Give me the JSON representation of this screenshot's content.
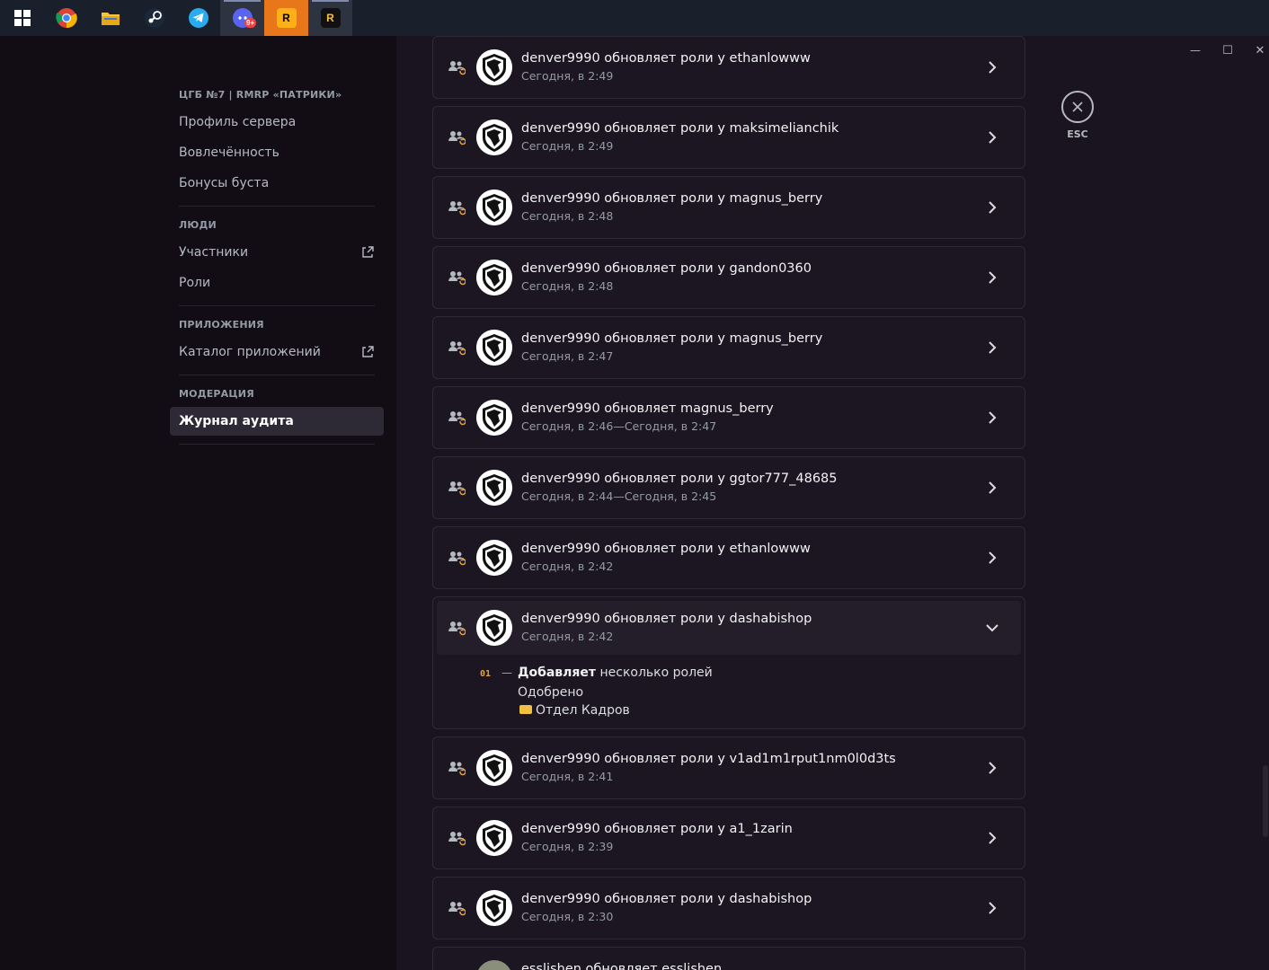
{
  "taskbar": {
    "items": [
      {
        "name": "windows-start",
        "label": ""
      },
      {
        "name": "chrome",
        "label": ""
      },
      {
        "name": "file-explorer",
        "label": ""
      },
      {
        "name": "steam",
        "label": ""
      },
      {
        "name": "telegram",
        "label": ""
      },
      {
        "name": "discord",
        "label": ""
      },
      {
        "name": "rockstar",
        "label": "R"
      },
      {
        "name": "rage-mp",
        "label": "R"
      }
    ],
    "discord_badge": "9+"
  },
  "window_controls": {
    "minimize": "—",
    "maximize": "☐",
    "close": "✕"
  },
  "sidebar": {
    "server_name": "ЦГБ №7 | RMRP «ПАТРИКИ»",
    "server_items": [
      "Профиль сервера",
      "Вовлечённость",
      "Бонусы буста"
    ],
    "people_header": "ЛЮДИ",
    "people_items": [
      "Участники",
      "Роли"
    ],
    "apps_header": "ПРИЛОЖЕНИЯ",
    "apps_items": [
      "Каталог приложений"
    ],
    "moderation_header": "МОДЕРАЦИЯ",
    "moderation_items": [
      "Журнал аудита"
    ]
  },
  "audit_log": {
    "entries": [
      {
        "title": "denver9990 обновляет роли у ethanlowww",
        "time": "Сегодня, в 2:49"
      },
      {
        "title": "denver9990 обновляет роли у maksimelianchik",
        "time": "Сегодня, в 2:49"
      },
      {
        "title": "denver9990 обновляет роли у magnus_berry",
        "time": "Сегодня, в 2:48"
      },
      {
        "title": "denver9990 обновляет роли у gandon0360",
        "time": "Сегодня, в 2:48"
      },
      {
        "title": "denver9990 обновляет роли у magnus_berry",
        "time": "Сегодня, в 2:47"
      },
      {
        "title": "denver9990 обновляет magnus_berry",
        "time": "Сегодня, в 2:46—Сегодня, в 2:47"
      },
      {
        "title": "denver9990 обновляет роли у ggtor777_48685",
        "time": "Сегодня, в 2:44—Сегодня, в 2:45"
      },
      {
        "title": "denver9990 обновляет роли у ethanlowww",
        "time": "Сегодня, в 2:42"
      },
      {
        "title": "denver9990 обновляет роли у dashabishop",
        "time": "Сегодня, в 2:42"
      },
      {
        "title": "denver9990 обновляет роли у v1ad1m1rput1nm0l0d3ts",
        "time": "Сегодня, в 2:41"
      },
      {
        "title": "denver9990 обновляет роли у a1_1zarin",
        "time": "Сегодня, в 2:39"
      },
      {
        "title": "denver9990 обновляет роли у dashabishop",
        "time": "Сегодня, в 2:30"
      },
      {
        "title": "esslishen обновляет esslishen",
        "time": ""
      }
    ],
    "expanded_detail": {
      "number": "01",
      "dash": "—",
      "title_bold": "Добавляет",
      "title_rest": " несколько ролей",
      "line1": "Одобрено",
      "line2": "Отдел Кадров"
    }
  },
  "esc": {
    "label": "ESC"
  },
  "colors": {
    "accent": "#e8a23c",
    "background": "#1a1420",
    "sidebar": "#120d15"
  }
}
